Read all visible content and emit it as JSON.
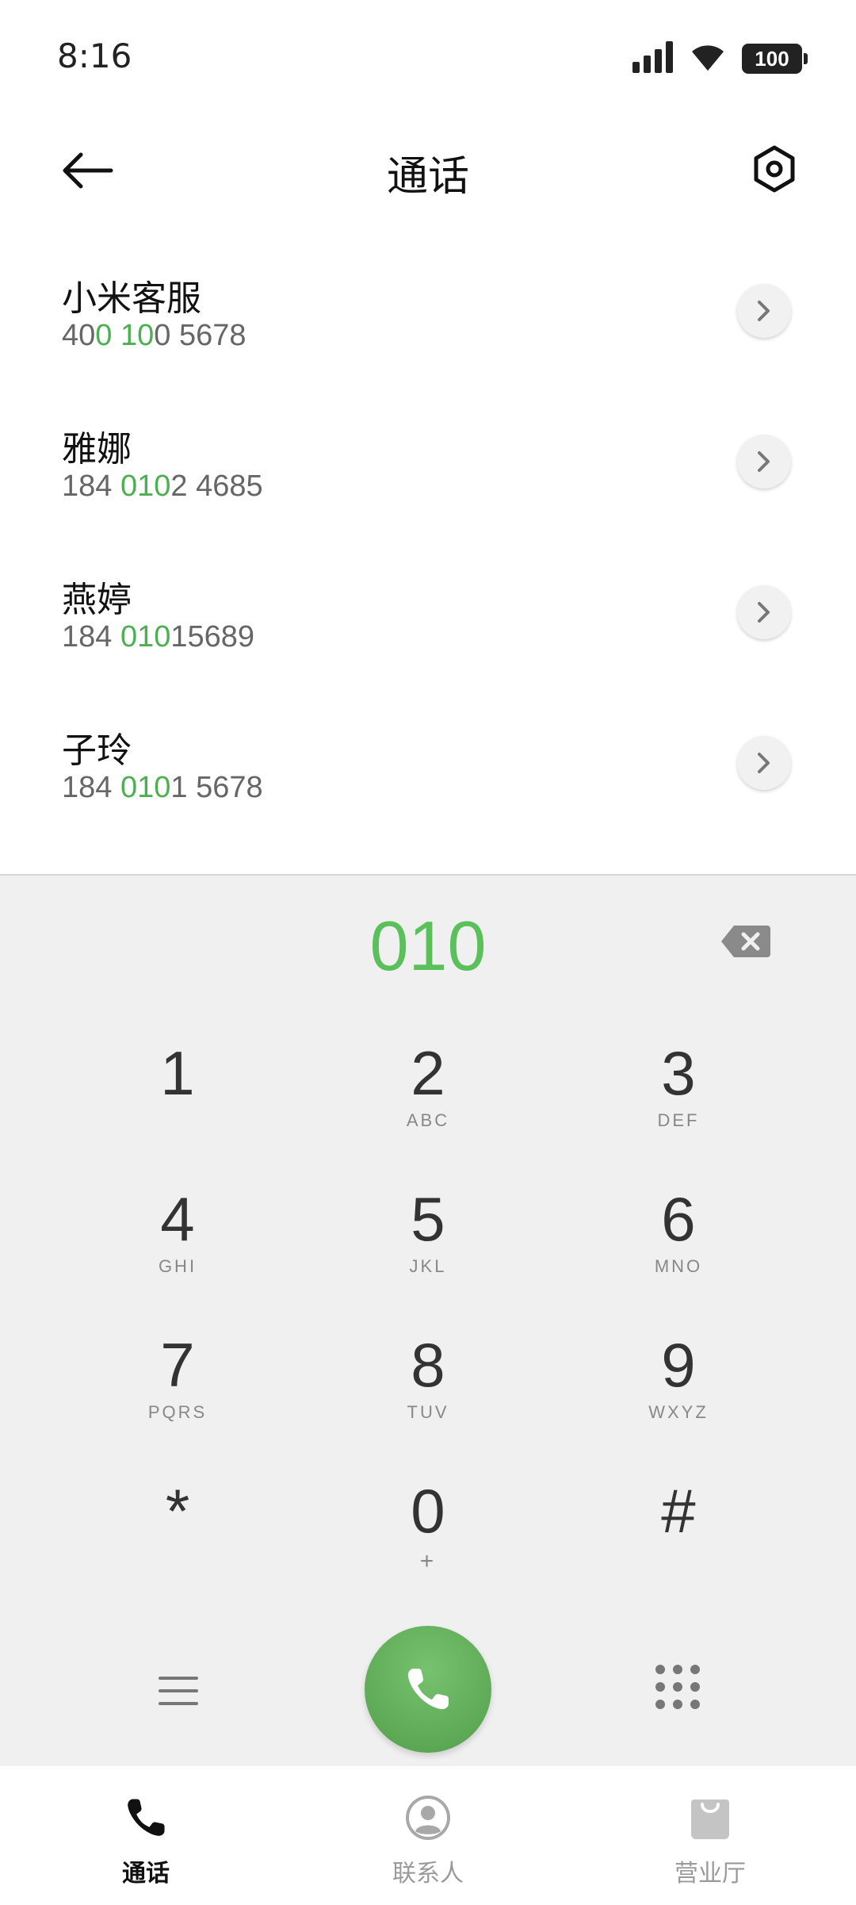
{
  "status_bar": {
    "time": "8:16",
    "battery": "100",
    "icons": [
      "signal-icon",
      "wifi-icon",
      "battery-icon"
    ]
  },
  "header": {
    "title": "通话",
    "back_icon": "arrow-left-icon",
    "settings_icon": "hexagon-settings-icon"
  },
  "contacts": [
    {
      "name": "小米客服",
      "number_parts": [
        [
          "40",
          false
        ],
        [
          "0 10",
          true
        ],
        [
          "0 5678",
          false
        ]
      ]
    },
    {
      "name": "雅娜",
      "number_parts": [
        [
          "184 ",
          false
        ],
        [
          "010",
          true
        ],
        [
          "2 4685",
          false
        ]
      ]
    },
    {
      "name": "燕婷",
      "number_parts": [
        [
          "184 ",
          false
        ],
        [
          "010",
          true
        ],
        [
          "15689",
          false
        ]
      ]
    },
    {
      "name": "子玲",
      "number_parts": [
        [
          "184 ",
          false
        ],
        [
          "010",
          true
        ],
        [
          "1 5678",
          false
        ]
      ]
    }
  ],
  "dialpad": {
    "input": "010",
    "keys": [
      {
        "digit": "1",
        "letters": ""
      },
      {
        "digit": "2",
        "letters": "ABC"
      },
      {
        "digit": "3",
        "letters": "DEF"
      },
      {
        "digit": "4",
        "letters": "GHI"
      },
      {
        "digit": "5",
        "letters": "JKL"
      },
      {
        "digit": "6",
        "letters": "MNO"
      },
      {
        "digit": "7",
        "letters": "PQRS"
      },
      {
        "digit": "8",
        "letters": "TUV"
      },
      {
        "digit": "9",
        "letters": "WXYZ"
      },
      {
        "digit": "*",
        "letters": ""
      },
      {
        "digit": "0",
        "letters": "+"
      },
      {
        "digit": "#",
        "letters": ""
      }
    ]
  },
  "bottom_nav": {
    "calls": "通话",
    "contacts": "联系人",
    "store": "营业厅"
  },
  "colors": {
    "accent_green": "#5ac05a",
    "call_button": "#5ea956",
    "dialpad_bg": "#f0f0f0"
  }
}
